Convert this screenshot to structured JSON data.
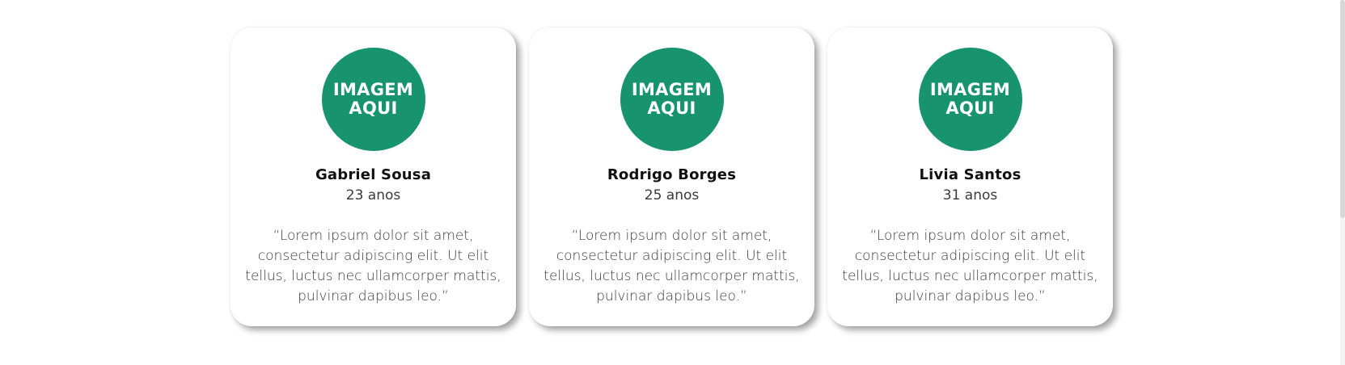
{
  "colors": {
    "avatar_bg": "#17946c",
    "card_bg": "#ffffff",
    "text": "#3a3a3a",
    "name": "#111111"
  },
  "cards": [
    {
      "avatar_text": "IMAGEM\nAQUI",
      "name": "Gabriel Sousa",
      "age": "23 anos",
      "quote": "“Lorem ipsum dolor sit amet, consectetur adipiscing elit. Ut elit tellus, luctus nec ullamcorper mattis, pulvinar dapibus leo.”"
    },
    {
      "avatar_text": "IMAGEM\nAQUI",
      "name": "Rodrigo Borges",
      "age": "25 anos",
      "quote": "“Lorem ipsum dolor sit amet, consectetur adipiscing elit. Ut elit tellus, luctus nec ullamcorper mattis, pulvinar dapibus leo.”"
    },
    {
      "avatar_text": "IMAGEM\nAQUI",
      "name": "Livia Santos",
      "age": "31 anos",
      "quote": "“Lorem ipsum dolor sit amet, consectetur adipiscing elit. Ut elit tellus, luctus nec ullamcorper mattis, pulvinar dapibus leo.”"
    }
  ]
}
